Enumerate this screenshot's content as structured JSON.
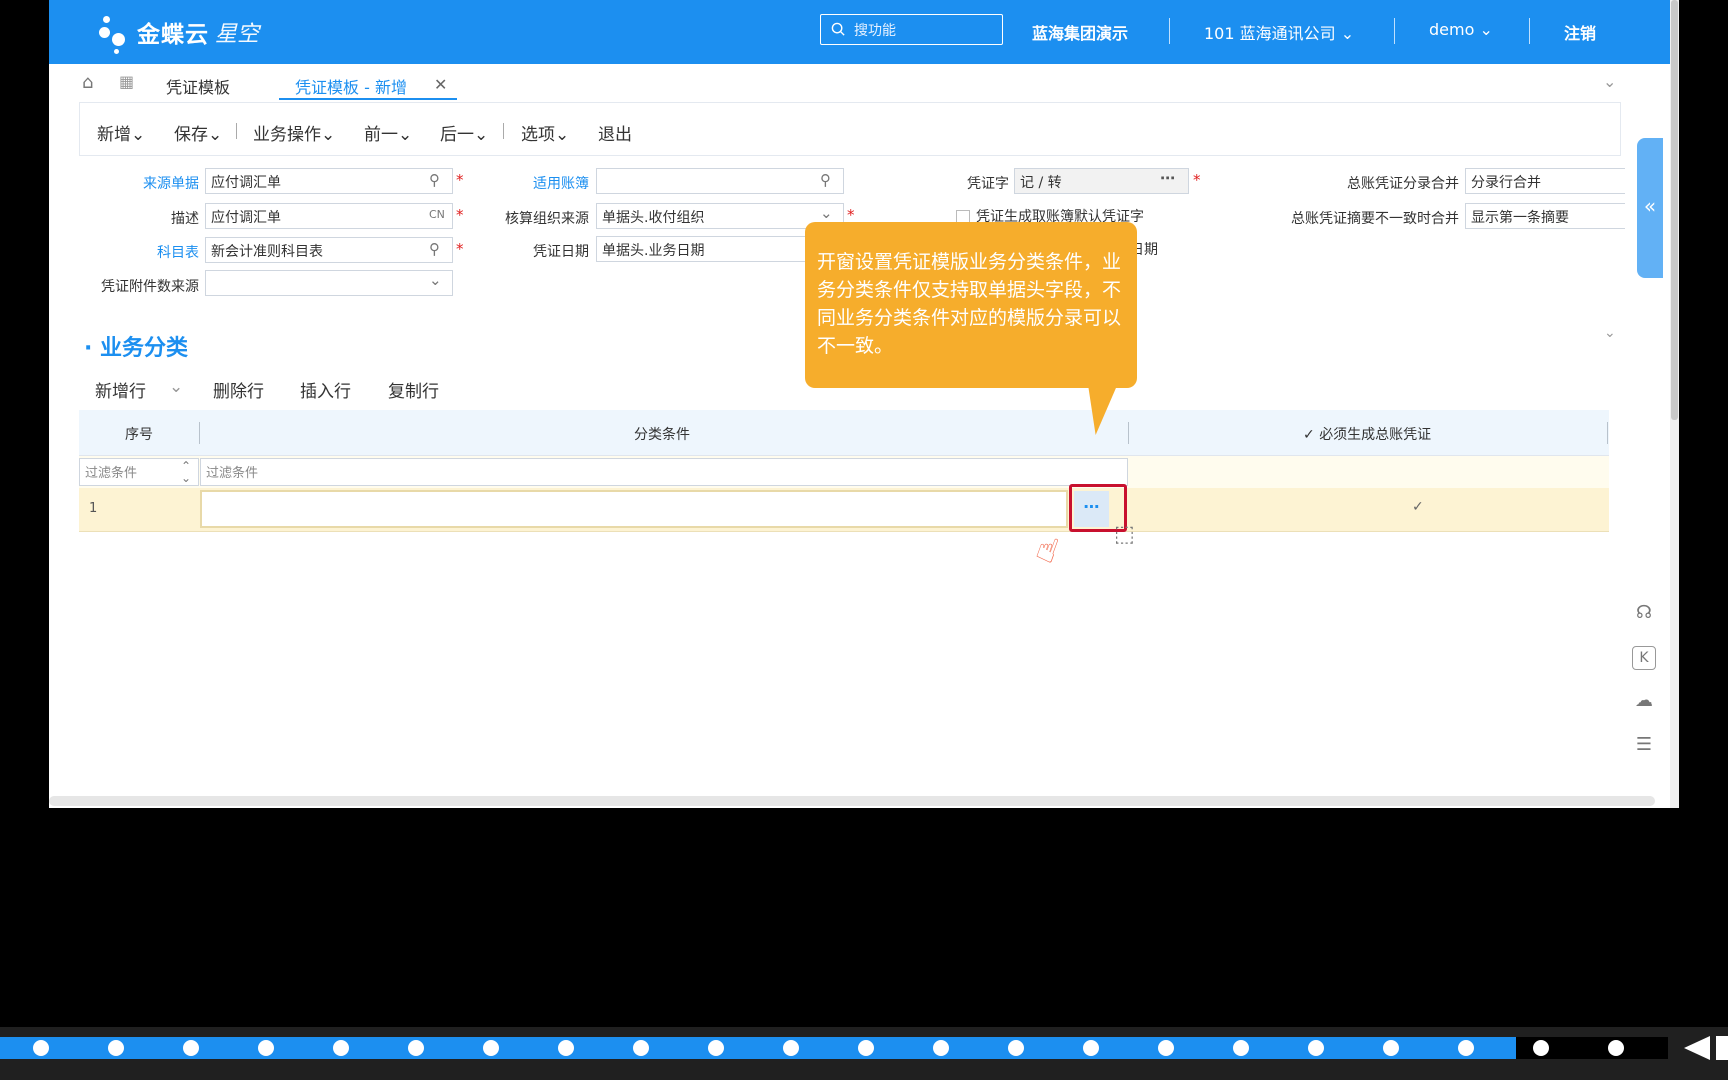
{
  "header": {
    "logo_text": "金蝶云",
    "logo_sub": "星空",
    "search_placeholder": "搜功能",
    "org_demo": "蓝海集团演示",
    "company": "101 蓝海通讯公司",
    "user": "demo",
    "logout": "注销"
  },
  "tabs": [
    "凭证模板",
    "凭证模板 - 新增"
  ],
  "toolbar": [
    "新增",
    "保存",
    "业务操作",
    "前一",
    "后一",
    "选项",
    "退出"
  ],
  "form": {
    "source_bill_label": "来源单据",
    "source_bill_value": "应付调汇单",
    "desc_label": "描述",
    "desc_value": "应付调汇单",
    "desc_suffix": "CN",
    "account_table_label": "科目表",
    "account_table_value": "新会计准则科目表",
    "attach_src_label": "凭证附件数来源",
    "book_label": "适用账簿",
    "org_src_label": "核算组织来源",
    "org_src_value": "单据头.收付组织",
    "date_label": "凭证日期",
    "date_value": "单据头.业务日期",
    "voucher_word_label": "凭证字",
    "voucher_word_value": "记 / 转",
    "default_word_text": "凭证生成取账簿默认凭证字",
    "date_tail": "日期",
    "merge_label": "总账凭证分录合并",
    "merge_value": "分录行合并",
    "summary_label": "总账凭证摘要不一致时合并",
    "summary_value": "显示第一条摘要"
  },
  "section": {
    "title": "业务分类",
    "actions": [
      "新增行",
      "删除行",
      "插入行",
      "复制行"
    ]
  },
  "grid": {
    "col_no": "序号",
    "col_condition": "分类条件",
    "col_must": "必须生成总账凭证",
    "filter_placeholder_1": "过滤条件",
    "filter_placeholder_2": "过滤条件",
    "row1_no": "1"
  },
  "callout": {
    "text": "开窗设置凭证模版业务分类条件，业务分类条件仅支持取单据头字段，不同业务分类条件对应的模版分录可以不一致。"
  },
  "colors": {
    "brand": "#1c8ff0",
    "callout": "#f6ad2c",
    "highlight": "#c8102e"
  }
}
